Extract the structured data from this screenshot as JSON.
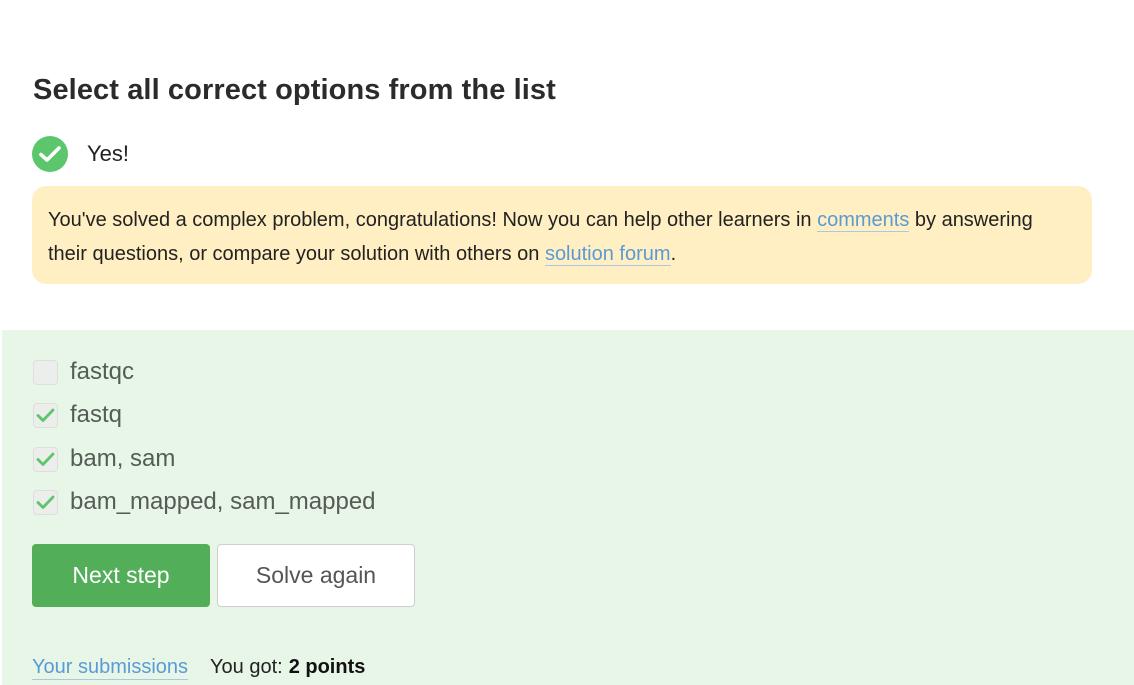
{
  "step": {
    "title": "Select all correct options from the list",
    "status": "Yes!",
    "feedback": {
      "before_comments": "You've solved a complex problem, congratulations! Now you can help other learners in ",
      "comments_link": "comments",
      "middle": " by answering their questions, or compare your solution with others on ",
      "forum_link": "solution forum",
      "after": "."
    }
  },
  "options": [
    {
      "label": "fastqc",
      "checked": false
    },
    {
      "label": "fastq",
      "checked": true
    },
    {
      "label": "bam, sam",
      "checked": true
    },
    {
      "label": "bam_mapped, sam_mapped",
      "checked": true
    }
  ],
  "actions": {
    "next_label": "Next step",
    "again_label": "Solve again"
  },
  "footer": {
    "submissions_link": "Your submissions",
    "score_prefix": "You got:",
    "score_value": "2 points"
  },
  "colors": {
    "success": "#5cc66c",
    "primary_button": "#52ae58",
    "hint_background": "#ffefc2",
    "answer_background": "#e7f6e7",
    "link": "#5b9bd5"
  }
}
